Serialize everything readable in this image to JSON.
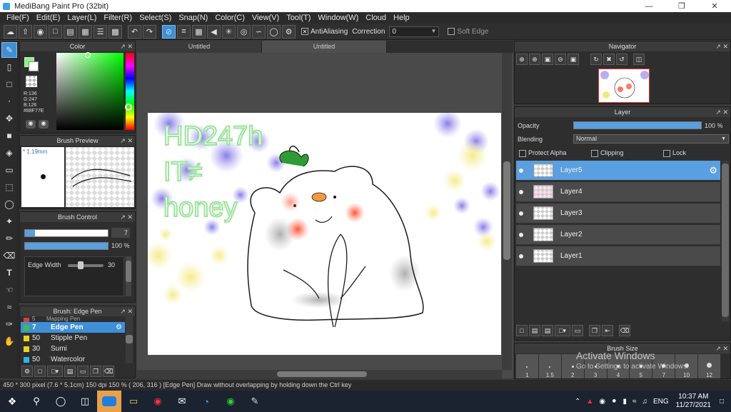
{
  "window": {
    "title": "MediBang Paint Pro (32bit)"
  },
  "menu": [
    "File(F)",
    "Edit(E)",
    "Layer(L)",
    "Filter(R)",
    "Select(S)",
    "Snap(N)",
    "Color(C)",
    "View(V)",
    "Tool(T)",
    "Window(W)",
    "Cloud",
    "Help"
  ],
  "toolbar": {
    "antialiasing_label": "AntiAliasing",
    "correction_label": "Correction",
    "correction_value": "0",
    "soft_edge_label": "Soft Edge"
  },
  "color_panel": {
    "title": "Color",
    "r": "R:136",
    "g": "G:247",
    "b": "B:126",
    "hex": "#88F77E",
    "current_color": "#88F77E"
  },
  "brush_preview": {
    "title": "Brush Preview",
    "size": "* 1.19mm"
  },
  "brush_control": {
    "title": "Brush Control",
    "size_value": "7",
    "opacity_value": "100 %",
    "edge_width_label": "Edge Width",
    "edge_width_value": "30"
  },
  "brush_list": {
    "title": "Brush: Edge Pen",
    "items": [
      {
        "size": "5",
        "name": "Mapping Pen",
        "color": "#d84040"
      },
      {
        "size": "7",
        "name": "Edge Pen",
        "color": "#3fbf3f",
        "selected": true
      },
      {
        "size": "50",
        "name": "Stipple Pen",
        "color": "#e6d51f"
      },
      {
        "size": "30",
        "name": "Sumi",
        "color": "#e6d51f"
      },
      {
        "size": "50",
        "name": "Watercolor",
        "color": "#29b6ea"
      }
    ]
  },
  "doc_tabs": [
    "Untitled",
    "Untitled"
  ],
  "canvas": {
    "text_lines": [
      "HD247h",
      "IT≠",
      "honey"
    ]
  },
  "navigator": {
    "title": "Navigator"
  },
  "layer_panel": {
    "title": "Layer",
    "opacity_label": "Opacity",
    "opacity_value": "100 %",
    "opacity": 1.0,
    "blending_label": "Blending",
    "blending_value": "Normal",
    "protect_alpha": "Protect Alpha",
    "clipping": "Clipping",
    "lock": "Lock",
    "layers": [
      "Layer5",
      "Layer4",
      "Layer3",
      "Layer2",
      "Layer1"
    ]
  },
  "brush_size_panel": {
    "title": "Brush Size",
    "sizes": [
      "1",
      "1.5",
      "2",
      "3",
      "4",
      "5",
      "7",
      "10",
      "12"
    ],
    "watermark_title": "Activate Windows",
    "watermark_sub": "Go to Settings to activate Windows."
  },
  "status": {
    "text": "450 * 300 pixel  (7.6 * 5.1cm)  150 dpi  150 %  ( 206, 316 )  [Edge Pen] Draw without overlapping by holding down the Ctrl key"
  },
  "taskbar": {
    "time": "10:37 AM",
    "date": "11/27/2021",
    "lang": "ENG"
  }
}
